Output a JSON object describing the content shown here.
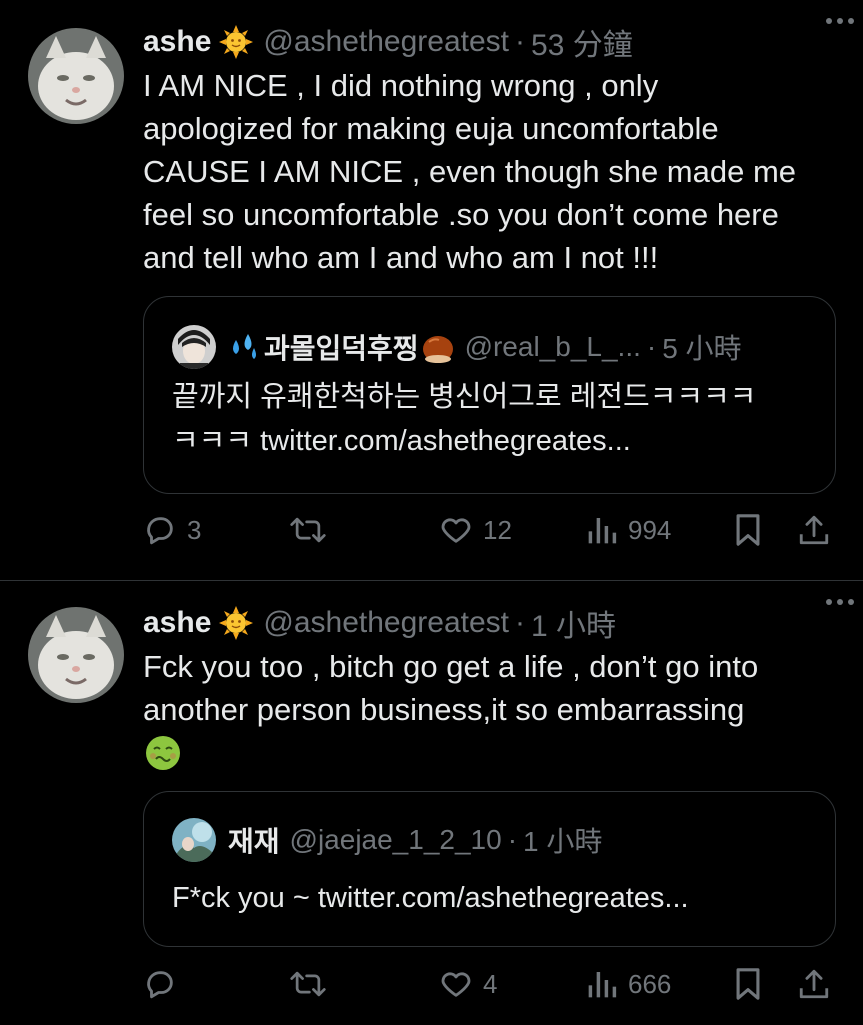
{
  "tweets": [
    {
      "author": {
        "name": "ashe",
        "verified_emoji": "sun-emoji",
        "handle": "@ashethegreatest"
      },
      "time": "53 分鐘",
      "text": "I AM NICE , I did nothing wrong , only\napologized for making euja uncomfortable\nCAUSE I AM NICE , even though she made me\nfeel so uncomfortable .so you don’t come here\nand tell who am I and who am I not !!!",
      "quote": {
        "name": "과몰입덕후찡",
        "name_prefix_icon": "sweat-droplets-emoji",
        "name_suffix_icon": "chestnut-emoji",
        "handle": "@real_b_L_...",
        "time": "5 小時",
        "text": "끝까지 유쾌한척하는 병신어그로 레전드ㅋㅋㅋㅋ\nㅋㅋㅋ twitter.com/ashethegreates..."
      },
      "actions": {
        "replies": "3",
        "retweets": "",
        "likes": "12",
        "views": "994"
      }
    },
    {
      "author": {
        "name": "ashe",
        "verified_emoji": "sun-emoji",
        "handle": "@ashethegreatest"
      },
      "time": "1 小時",
      "text": "Fck you too , bitch go get a life , don’t go into\nanother person business,it so embarrassing",
      "text_emoji": "nauseated-face-emoji",
      "quote": {
        "name": "재재",
        "handle": "@jaejae_1_2_10",
        "time": "1 小時",
        "text": "F*ck you ~ twitter.com/ashethegreates..."
      },
      "actions": {
        "replies": "",
        "retweets": "",
        "likes": "4",
        "views": "666"
      }
    }
  ],
  "colors": {
    "background": "#000000",
    "text": "#e7e9ea",
    "secondary": "#71767b",
    "border": "#2f3336"
  }
}
